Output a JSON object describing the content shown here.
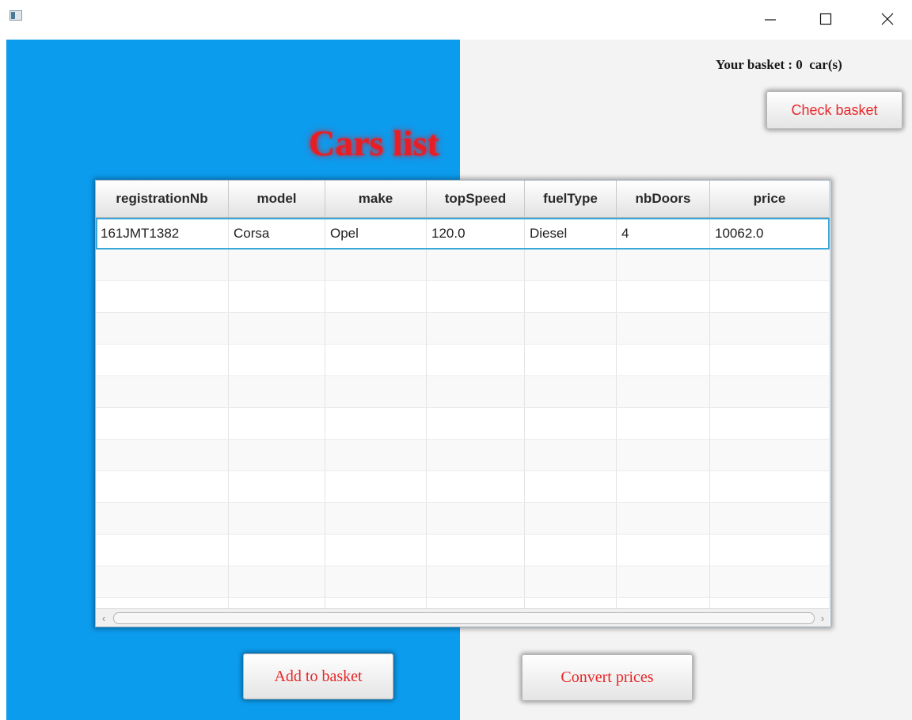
{
  "window": {
    "controls": {
      "minimize": "minimize-icon",
      "maximize": "maximize-icon",
      "close": "close-icon"
    }
  },
  "header": {
    "basket_text": "Your basket : 0  car(s)",
    "check_basket_label": "Check basket",
    "title": "Cars list"
  },
  "table": {
    "columns": [
      "registrationNb",
      "model",
      "make",
      "topSpeed",
      "fuelType",
      "nbDoors",
      "price"
    ],
    "rows": [
      [
        "161JMT1382",
        "Corsa",
        "Opel",
        "120.0",
        "Diesel",
        "4",
        "10062.0"
      ]
    ]
  },
  "actions": {
    "add_label": "Add to basket",
    "convert_label": "Convert prices"
  },
  "colors": {
    "accent": "#e8272a",
    "panel_blue": "#0c9cee",
    "selection": "#39a8d9"
  }
}
